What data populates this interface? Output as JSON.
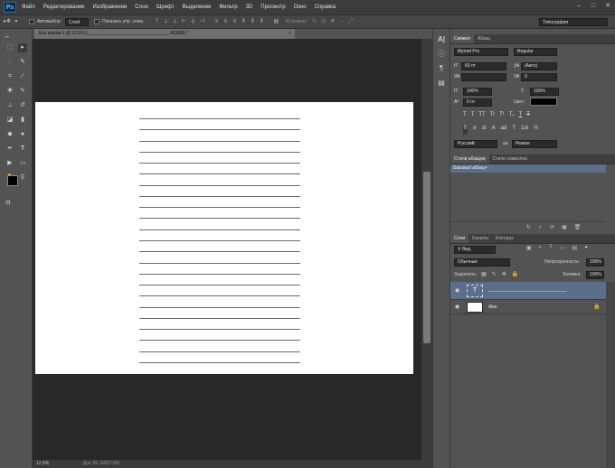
{
  "app": {
    "logo": "Ps"
  },
  "menu": [
    "Файл",
    "Редактирование",
    "Изображение",
    "Слои",
    "Шрифт",
    "Выделение",
    "Фильтр",
    "3D",
    "Просмотр",
    "Окно",
    "Справка"
  ],
  "window_controls": [
    "–",
    "□",
    "✕"
  ],
  "options_bar": {
    "autoselect_label": "Автовыбор:",
    "autoselect_value": "Слой",
    "show_controls_label": "Показать упр. элем.",
    "mode_3d_label": "3D-режим:",
    "workspace_value": "Типография"
  },
  "document": {
    "tab_title": "Без имени-1 @ 12,5% (________________________________, RGB/8) *",
    "close": "×",
    "line_count": 23
  },
  "status": {
    "zoom": "12,5%",
    "doc_info": "Док: 86,1M/27,6M"
  },
  "character_panel": {
    "tabs": [
      "Символ",
      "Абзац"
    ],
    "font_family": "Myriad Pro",
    "font_style": "Regular",
    "font_size": "60 пт",
    "leading": "(Авто)",
    "kerning": "",
    "tracking": "0",
    "vertical_scale": "100%",
    "horizontal_scale": "100%",
    "baseline_shift": "0 пт",
    "color_label": "Цвет:",
    "type_buttons": [
      "T",
      "T",
      "TT",
      "Tr",
      "T¹",
      "T₁",
      "T",
      "T"
    ],
    "opentype_buttons": [
      "fi",
      "ơ",
      "st",
      "A",
      "ad",
      "T",
      "1st",
      "½"
    ],
    "language": "Русский",
    "antialias_label": "aa",
    "antialias": "Резкое"
  },
  "paragraph_styles_panel": {
    "tabs": [
      "Стили абзацев",
      "Стили символов"
    ],
    "items": [
      "Базовый абзац+"
    ]
  },
  "layers_panel": {
    "tabs": [
      "Слои",
      "Каналы",
      "Контуры"
    ],
    "filter_label": "Вид",
    "blend_mode": "Обычные",
    "opacity_label": "Непрозрачность:",
    "opacity_value": "100%",
    "lock_label": "Закрепить:",
    "fill_label": "Заливка:",
    "fill_value": "100%",
    "layers": [
      {
        "name": "_______________________________",
        "type_icon": "T",
        "selected": true
      },
      {
        "name": "Фон",
        "type_icon": "",
        "selected": false
      }
    ]
  },
  "colors": {
    "menubar": "#3c3c3c",
    "panel": "#535353",
    "canvas_bg": "#282828",
    "selection": "#5b6f8a"
  }
}
